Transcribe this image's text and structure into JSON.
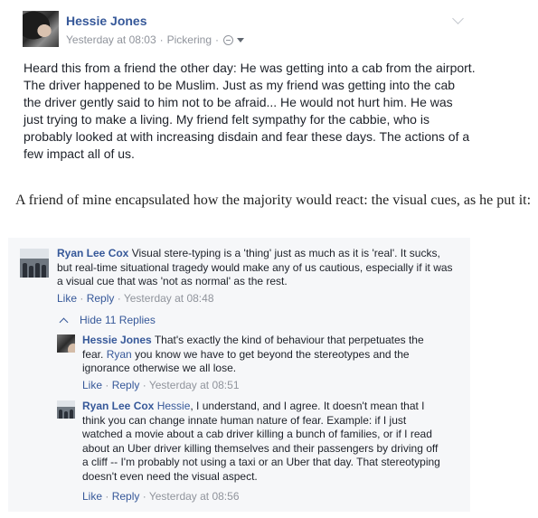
{
  "post": {
    "author": "Hessie Jones",
    "timestamp": "Yesterday at 08:03",
    "location": "Pickering",
    "separator": "·",
    "privacy_icon": "globe-icon",
    "body": "Heard this from a friend the other day: He was getting into a cab from the airport. The driver happened to be Muslim. Just as my friend was getting into the cab the driver gently said to him not to be afraid... He would not hurt him. He was just trying to make a living. My friend felt sympathy for the cabbie, who is probably looked at with increasing disdain and fear these days. The actions of a few impact all of us."
  },
  "article": {
    "paragraph": "A friend of mine encapsulated how the majority would react: the visual cues, as he put it:"
  },
  "comments": {
    "top": {
      "author": "Ryan Lee Cox",
      "text": "Visual stere-typing is a 'thing' just as much as it is 'real'. It sucks, but real-time situational tragedy would make any of us cautious, especially if it was a visual cue that was 'not as normal' as the rest.",
      "like": "Like",
      "reply": "Reply",
      "sep": "·",
      "time": "Yesterday at 08:48"
    },
    "hide_replies": "Hide 11 Replies",
    "replies": [
      {
        "author": "Hessie Jones",
        "text_before": "That's exactly the kind of behaviour that perpetuates the fear.",
        "mention": "Ryan",
        "text_after": "you know we have to get beyond the stereotypes and the ignorance otherwise we all lose.",
        "like": "Like",
        "reply": "Reply",
        "sep": "·",
        "time": "Yesterday at 08:51"
      },
      {
        "author": "Ryan Lee Cox",
        "mention": "Hessie",
        "text_after": ", I understand, and I agree. It doesn't mean that I think you can change innate human nature of fear. Example: if I just watched a movie about a cab driver killing a bunch of families, or if I read about an Uber driver killing themselves and their passengers by driving off a cliff -- I'm probably not using a taxi or an Uber that day. That stereotyping doesn't even need the visual aspect.",
        "like": "Like",
        "reply": "Reply",
        "sep": "·",
        "time": "Yesterday at 08:56"
      }
    ]
  },
  "colors": {
    "link": "#365899",
    "meta": "#90949c",
    "text": "#1d2129",
    "comment_bg": "#f6f7f9"
  }
}
